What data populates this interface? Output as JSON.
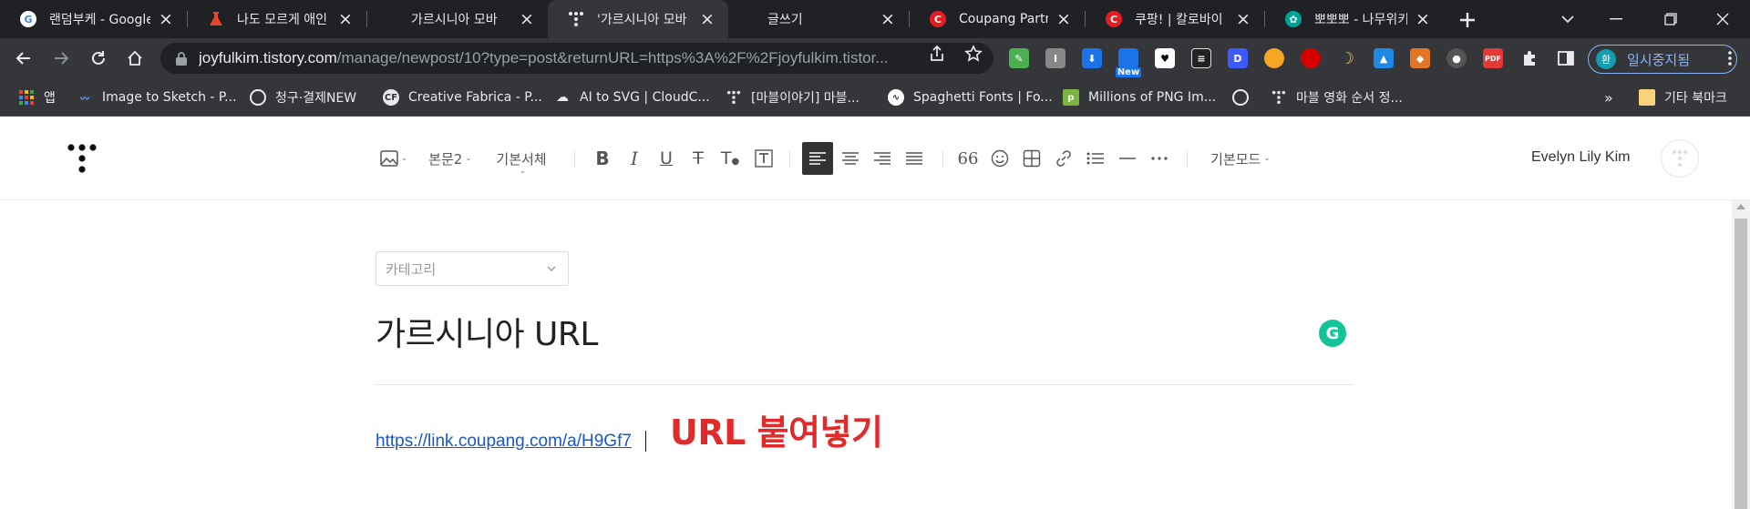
{
  "browser": {
    "tabs": [
      {
        "title": "랜덤부케 - Google",
        "icon": "google-icon",
        "color": "#4285f4"
      },
      {
        "title": "나도 모르게 애인",
        "icon": "flask-icon",
        "color": "#e8452c"
      },
      {
        "title": "가르시니아 모바",
        "icon": "",
        "color": ""
      },
      {
        "title": "'가르시니아 모바",
        "icon": "tistory-icon",
        "color": "#ffffff"
      },
      {
        "title": "글쓰기",
        "icon": "",
        "color": ""
      },
      {
        "title": "Coupang Partners",
        "icon": "coupang-icon",
        "color": "#e41c24"
      },
      {
        "title": "쿠팡! | 칼로바이",
        "icon": "coupang-icon",
        "color": "#e41c24"
      },
      {
        "title": "뽀뽀뽀 - 나무위키",
        "icon": "namuwiki-icon",
        "color": "#00a495"
      }
    ],
    "active_tab_index": 3,
    "omnibox": {
      "host": "joyfulkim.tistory.com",
      "path": "/manage/newpost/10?type=post&returnURL=https%3A%2F%2Fjoyfulkim.tistor..."
    },
    "extensions_new_badge": "New",
    "profile": {
      "initial": "환",
      "label": "일시중지됨"
    },
    "bookmarks": [
      {
        "label": "앱",
        "icon": "apps-grid-icon"
      },
      {
        "label": "Image to Sketch - P...",
        "icon": "sketch-icon"
      },
      {
        "label": "청구·결제NEW",
        "icon": "globe-icon"
      },
      {
        "label": "Creative Fabrica - P...",
        "icon": "creative-fabrica-icon"
      },
      {
        "label": "AI to SVG | CloudC...",
        "icon": "cloud-icon"
      },
      {
        "label": "[마블이야기] 마블...",
        "icon": "tistory-icon"
      },
      {
        "label": "Spaghetti Fonts | Fo...",
        "icon": "spaghetti-icon"
      },
      {
        "label": "Millions of PNG Im...",
        "icon": "pngimg-icon"
      },
      {
        "label": "",
        "icon": "globe-icon"
      },
      {
        "label": "마블 영화 순서 정...",
        "icon": "tistory-icon"
      }
    ],
    "bookmarks_overflow": "»",
    "other_bookmarks": "기타 북마크"
  },
  "editor": {
    "toolbar": {
      "paragraph_style": "본문2",
      "font": "기본서체",
      "quote_glyph": "66",
      "mode": "기본모드"
    },
    "user_name": "Evelyn Lily Kim",
    "category_placeholder": "카테고리",
    "title": "가르시니아 URL",
    "body_link": "https://link.coupang.com/a/H9Gf7",
    "annotation": "URL 붙여넣기",
    "grammarly_letter": "G"
  },
  "colors": {
    "annotation": "#e22a2a",
    "link": "#1a57c5",
    "active_align_button": "#333333"
  }
}
